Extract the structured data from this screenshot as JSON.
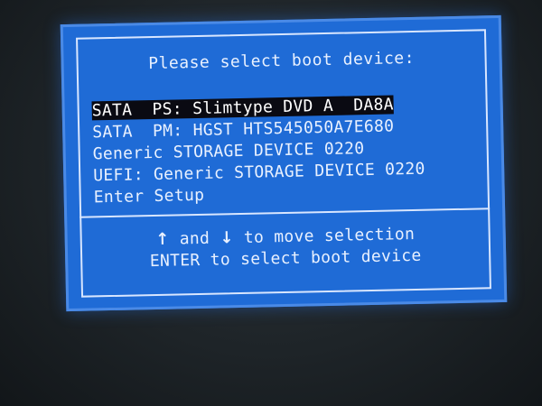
{
  "dialog": {
    "title": "Please select boot device:",
    "items": [
      {
        "label": "SATA  PS: Slimtype DVD A  DA8A",
        "selected": true
      },
      {
        "label": "SATA  PM: HGST HTS545050A7E680",
        "selected": false
      },
      {
        "label": "Generic STORAGE DEVICE 0220",
        "selected": false
      },
      {
        "label": "UEFI: Generic STORAGE DEVICE 0220",
        "selected": false
      },
      {
        "label": "Enter Setup",
        "selected": false
      }
    ],
    "help": {
      "up_arrow_icon": "↑",
      "and_text": "and",
      "down_arrow_icon": "↓",
      "move_text": "to move selection",
      "enter_text": "ENTER to select boot device"
    }
  },
  "colors": {
    "dialog_bg": "#1f6bd6",
    "text": "#e9f1ff",
    "highlight_bg": "#0a0a12",
    "screen_bg": "#1b2024"
  }
}
